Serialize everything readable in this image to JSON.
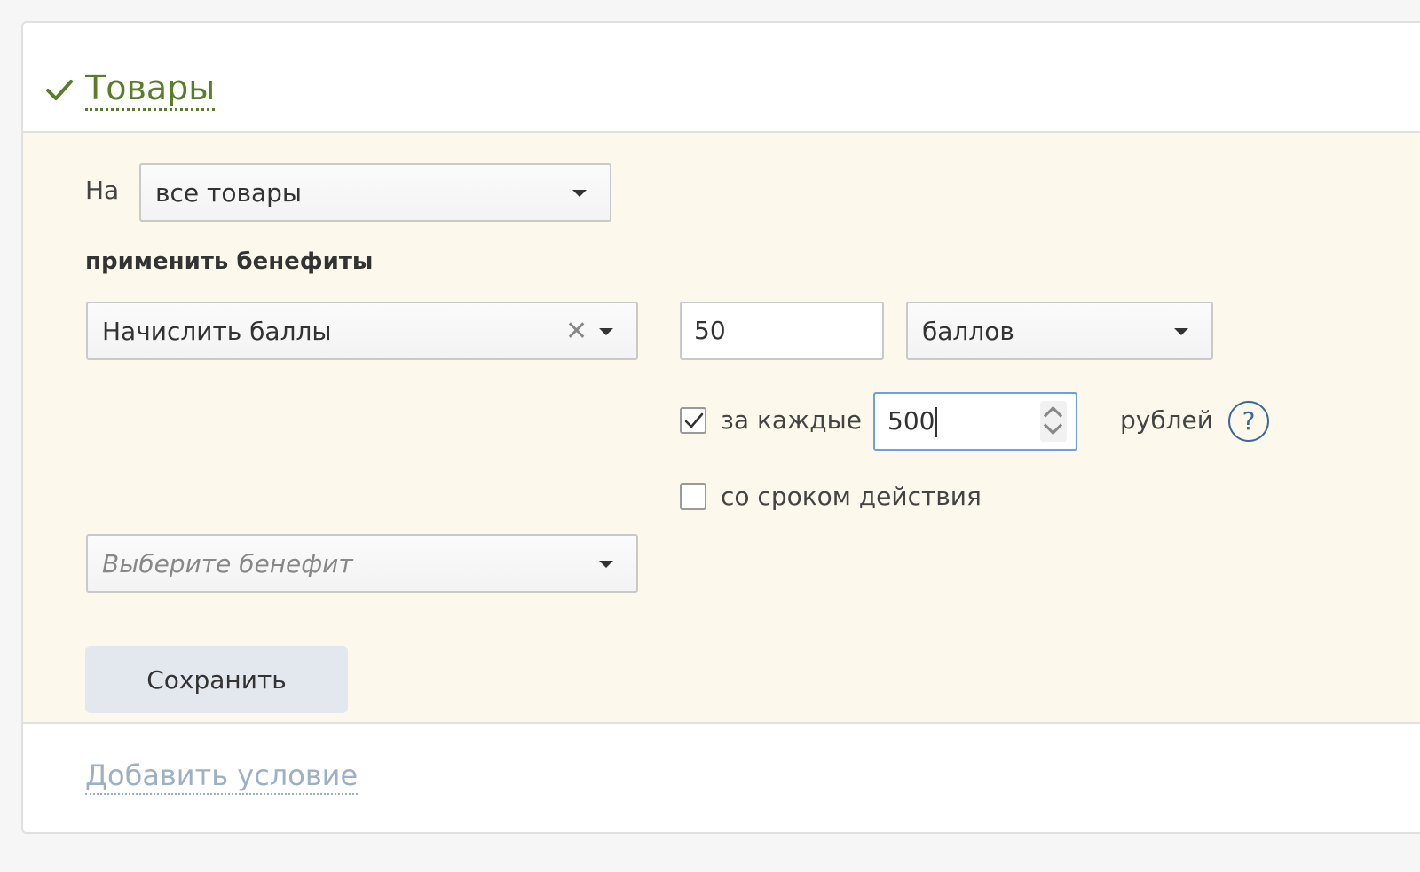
{
  "section": {
    "title": "Товары",
    "check_icon": "check-icon"
  },
  "condition": {
    "on_label": "На",
    "target_select": {
      "value": "все товары"
    },
    "benefits_label": "применить бенефиты"
  },
  "benefit": {
    "type_select": {
      "value": "Начислить баллы"
    },
    "amount_input": {
      "value": "50"
    },
    "unit_select": {
      "value": "баллов"
    },
    "per_each": {
      "checked": true,
      "label": "за каждые"
    },
    "per_each_input": {
      "value": "500"
    },
    "currency_label": "рублей",
    "help_icon_text": "?",
    "expiry": {
      "checked": false,
      "label": "со сроком действия"
    }
  },
  "new_benefit_select": {
    "placeholder": "Выберите бенефит"
  },
  "actions": {
    "save_label": "Сохранить",
    "add_condition_label": "Добавить условие"
  },
  "colors": {
    "title_green": "#5a7d2a",
    "body_bg": "#fcf8ec",
    "focus_blue": "#6f9fe0",
    "link_muted": "#9db0c4"
  }
}
